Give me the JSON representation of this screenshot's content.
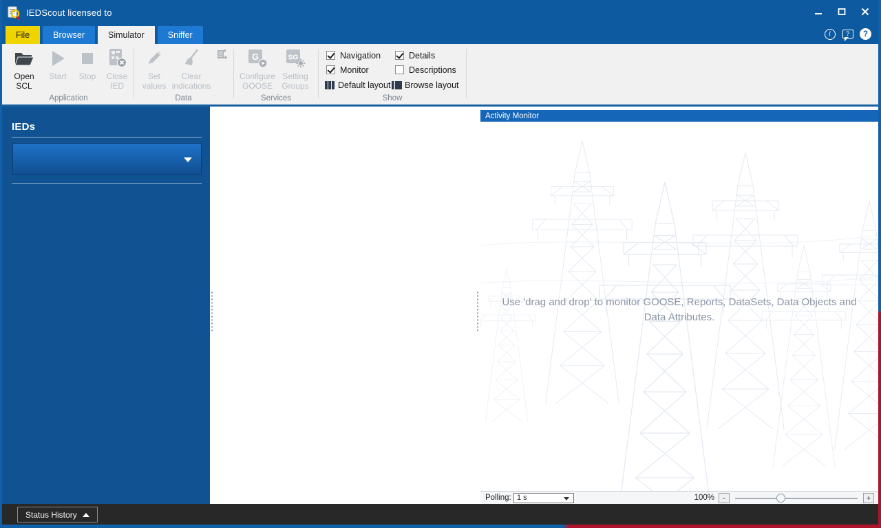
{
  "colors": {
    "titlebar_blue": "#0d5aa0",
    "accent_blue": "#1565b8",
    "sidebar_blue": "#115293",
    "tab_yellow": "#f0d400",
    "tab_blue": "#1d79d2",
    "brand_red": "#b0142d",
    "statusbar_dark": "#282828",
    "disabled_gray": "#b9bfc6"
  },
  "titlebar": {
    "title": "IEDScout licensed to"
  },
  "tabs": {
    "file": "File",
    "browser": "Browser",
    "simulator": "Simulator",
    "sniffer": "Sniffer",
    "active": "Simulator"
  },
  "icons": {
    "info_glyph": "i",
    "feedback_glyph": "?",
    "help_glyph": "?",
    "goose_abbr": "G",
    "setting_groups_abbr": "SG"
  },
  "ribbon": {
    "application": {
      "label": "Application",
      "open_scl": "Open SCL",
      "start": "Start",
      "stop": "Stop",
      "close_ied": "Close IED",
      "enabled": {
        "open_scl": true,
        "start": false,
        "stop": false,
        "close_ied": false
      }
    },
    "data": {
      "label": "Data",
      "set_values": "Set values",
      "clear_indications": "Clear indications",
      "enabled": {
        "set_values": false,
        "clear_indications": false
      }
    },
    "services": {
      "label": "Services",
      "configure_goose": "Configure GOOSE",
      "setting_groups": "Setting Groups",
      "enabled": {
        "configure_goose": false,
        "setting_groups": false
      }
    },
    "show": {
      "label": "Show",
      "navigation": "Navigation",
      "monitor": "Monitor",
      "details": "Details",
      "descriptions": "Descriptions",
      "checked": {
        "navigation": true,
        "monitor": true,
        "details": true,
        "descriptions": false
      },
      "default_layout": "Default layout",
      "browse_layout": "Browse layout"
    }
  },
  "sidebar": {
    "heading": "IEDs",
    "ied_dropdown_value": ""
  },
  "activity_monitor": {
    "title": "Activity Monitor",
    "hint": "Use 'drag and drop' to monitor GOOSE, Reports, DataSets, Data Objects and Data Attributes.",
    "polling_label": "Polling:",
    "polling_value": "1 s",
    "zoom_level": "100%",
    "zoom_out_label": "-",
    "zoom_in_label": "+"
  },
  "statusbar": {
    "status_history": "Status History"
  }
}
